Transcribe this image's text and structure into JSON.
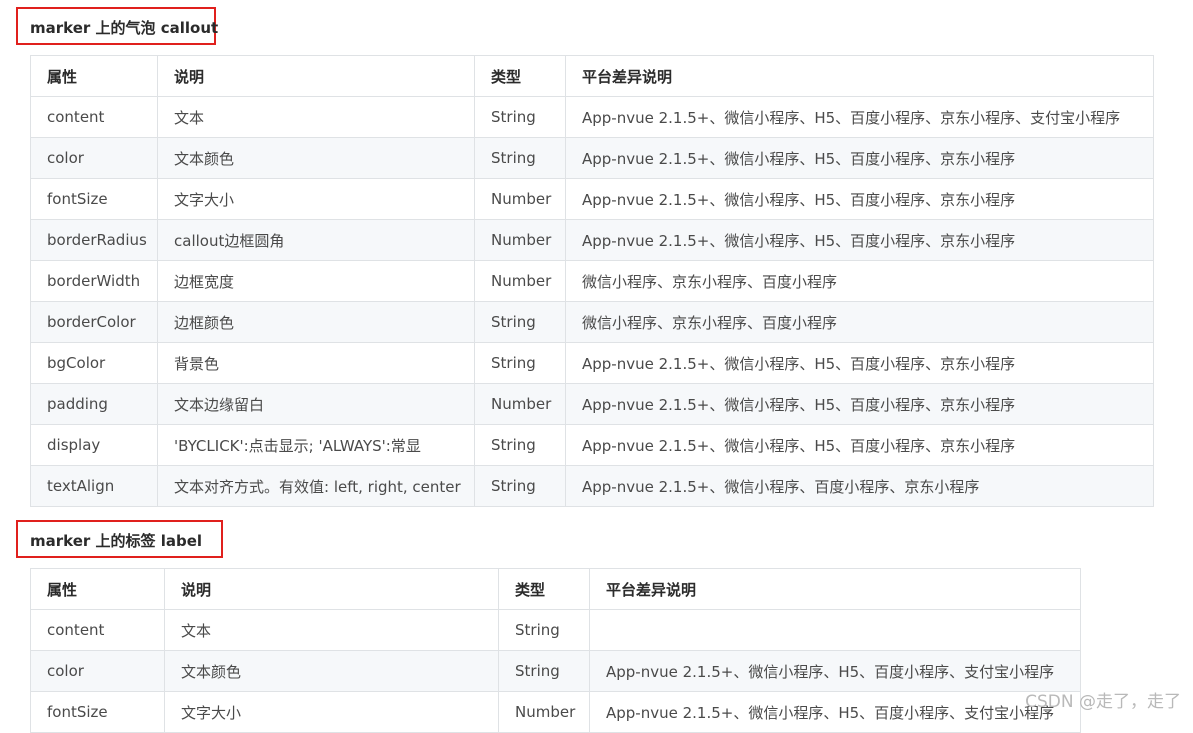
{
  "sections": [
    {
      "title": "marker 上的气泡 callout",
      "headers": [
        "属性",
        "说明",
        "类型",
        "平台差异说明"
      ],
      "rows": [
        [
          "content",
          "文本",
          "String",
          "App-nvue 2.1.5+、微信小程序、H5、百度小程序、京东小程序、支付宝小程序"
        ],
        [
          "color",
          "文本颜色",
          "String",
          "App-nvue 2.1.5+、微信小程序、H5、百度小程序、京东小程序"
        ],
        [
          "fontSize",
          "文字大小",
          "Number",
          "App-nvue 2.1.5+、微信小程序、H5、百度小程序、京东小程序"
        ],
        [
          "borderRadius",
          "callout边框圆角",
          "Number",
          "App-nvue 2.1.5+、微信小程序、H5、百度小程序、京东小程序"
        ],
        [
          "borderWidth",
          "边框宽度",
          "Number",
          "微信小程序、京东小程序、百度小程序"
        ],
        [
          "borderColor",
          "边框颜色",
          "String",
          "微信小程序、京东小程序、百度小程序"
        ],
        [
          "bgColor",
          "背景色",
          "String",
          "App-nvue 2.1.5+、微信小程序、H5、百度小程序、京东小程序"
        ],
        [
          "padding",
          "文本边缘留白",
          "Number",
          "App-nvue 2.1.5+、微信小程序、H5、百度小程序、京东小程序"
        ],
        [
          "display",
          "'BYCLICK':点击显示; 'ALWAYS':常显",
          "String",
          "App-nvue 2.1.5+、微信小程序、H5、百度小程序、京东小程序"
        ],
        [
          "textAlign",
          "文本对齐方式。有效值: left, right, center",
          "String",
          "App-nvue 2.1.5+、微信小程序、百度小程序、京东小程序"
        ]
      ]
    },
    {
      "title": "marker 上的标签 label",
      "headers": [
        "属性",
        "说明",
        "类型",
        "平台差异说明"
      ],
      "rows": [
        [
          "content",
          "文本",
          "String",
          ""
        ],
        [
          "color",
          "文本颜色",
          "String",
          "App-nvue 2.1.5+、微信小程序、H5、百度小程序、支付宝小程序"
        ],
        [
          "fontSize",
          "文字大小",
          "Number",
          "App-nvue 2.1.5+、微信小程序、H5、百度小程序、支付宝小程序"
        ]
      ]
    }
  ],
  "watermark": "CSDN @走了，走了",
  "colors": {
    "highlight_border": "#e0201d",
    "table_border": "#dfe2e5",
    "row_stripe": "#f6f8fa"
  }
}
